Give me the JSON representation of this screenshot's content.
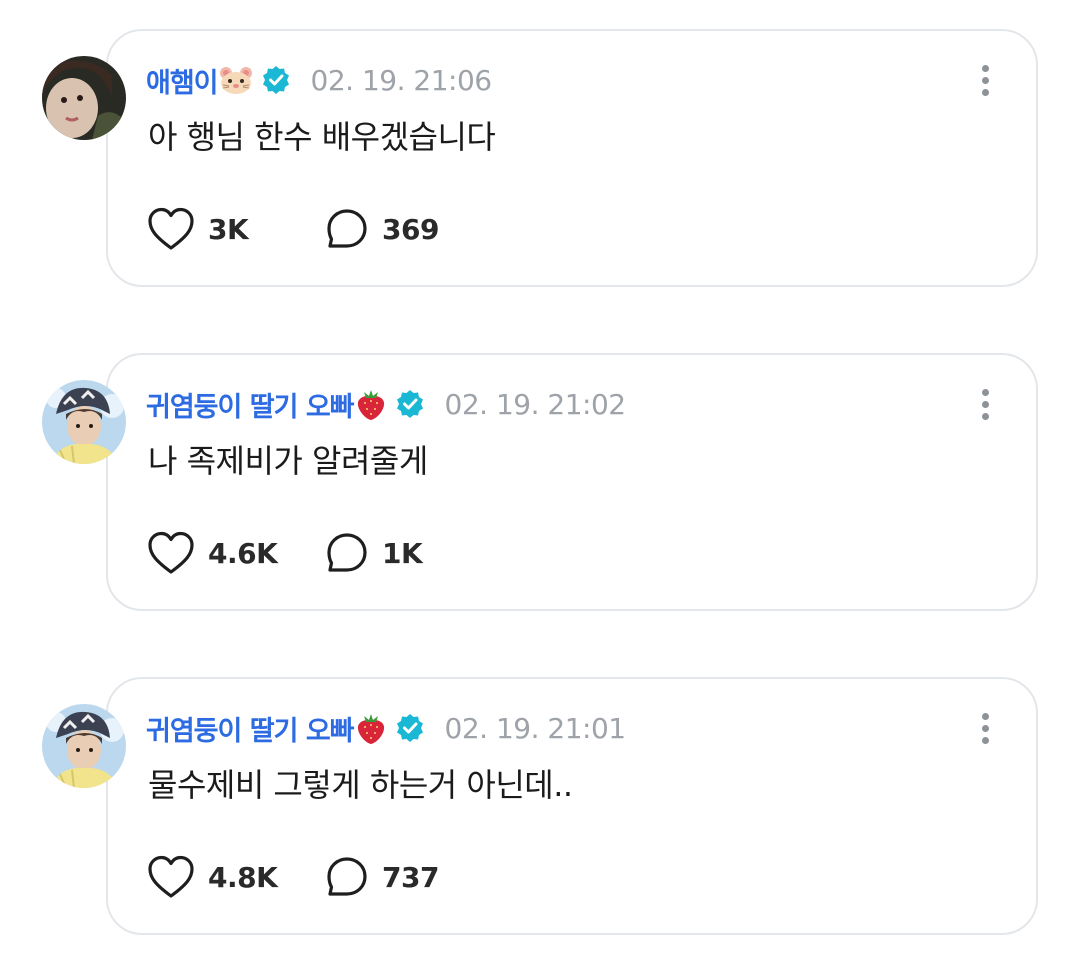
{
  "posts": [
    {
      "author": "애햄이",
      "author_emoji": "hamster-face-emoji",
      "verified": true,
      "timestamp": "02. 19. 21:06",
      "text": "아 행님 한수 배우겠습니다",
      "likes": "3K",
      "comments": "369"
    },
    {
      "author": "귀염둥이 딸기 오빠",
      "author_emoji": "strawberry-emoji",
      "verified": true,
      "timestamp": "02. 19. 21:02",
      "text": "나 족제비가 알려줄게",
      "likes": "4.6K",
      "comments": "1K"
    },
    {
      "author": "귀염둥이 딸기 오빠",
      "author_emoji": "strawberry-emoji",
      "verified": true,
      "timestamp": "02. 19. 21:01",
      "text": "물수제비 그렇게 하는거 아닌데..",
      "likes": "4.8K",
      "comments": "737"
    }
  ],
  "icons": {
    "like": "heart-outline-icon",
    "comment": "speech-bubble-outline-icon",
    "more": "vertical-ellipsis-icon",
    "verified": "verified-check-badge-icon"
  },
  "colors": {
    "author_name": "#2d6be2",
    "verified_badge": "#1ab8d4",
    "timestamp": "#9ea3a9",
    "card_border": "#e3e6ea"
  }
}
